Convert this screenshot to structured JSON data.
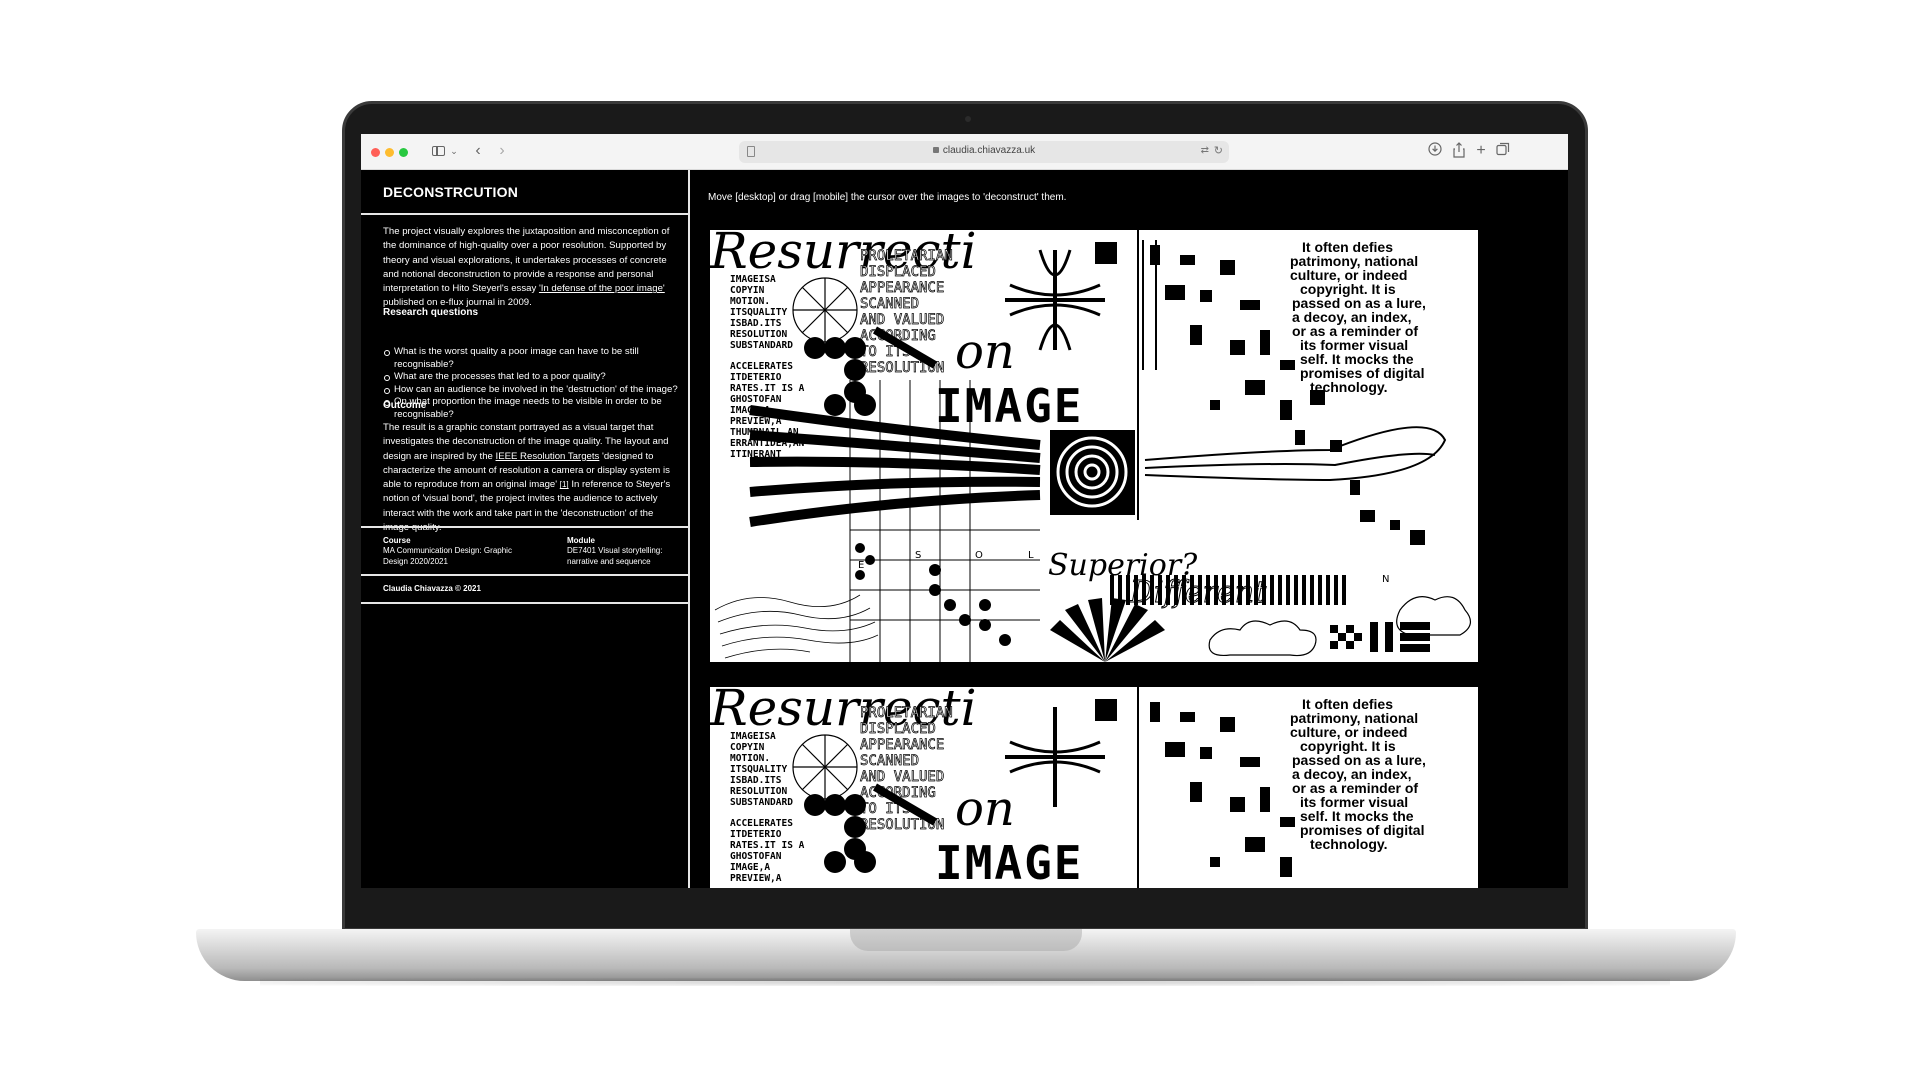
{
  "browser": {
    "url": "claudia.chiavazza.uk"
  },
  "sidebar": {
    "title": "DECONSTRCUTION",
    "intro_pre": "The project visually explores the juxtaposition and misconception of the dominance of high-quality over a poor resolution. Supported by theory and visual explorations, it undertakes processes of concrete and notional deconstruction to provide a response and personal interpretation to Hito Steyerl's essay ",
    "intro_link": "'In defense of the poor image'",
    "intro_post": " published on e-flux journal in 2009.",
    "research_heading": "Research questions",
    "research_questions": [
      "What is the worst quality a poor image can have to be still recognisable?",
      "What are the processes that led to a poor quality?",
      "How can an audience be involved in the 'destruction' of the image?",
      "On what proportion the image needs to be visible in order to be recognisable?"
    ],
    "outcome_heading": "Outcome",
    "outcome_pre": "The result is a graphic constant portrayed as a visual target that investigates the deconstruction of the image quality. The layout and design are inspired by the ",
    "outcome_link": "IEEE Resolution Targets",
    "outcome_mid": " 'designed to characterize the amount of resolution a camera or display system is able to reproduce from an original image' ",
    "outcome_ref": "[1]",
    "outcome_post": " In reference to Steyer's notion of 'visual bond', the project invites the audience to actively interact with the work and take part in the 'deconstruction' of the image quality.",
    "course_label": "Course",
    "course_value": "MA Communication Design: Graphic Design 2020/2021",
    "module_label": "Module",
    "module_value": "DE7401 Visual storytelling: narrative and sequence",
    "copyright": "Claudia Chiavazza © 2021"
  },
  "main": {
    "instruction": "Move [desktop] or drag [mobile] the cursor over the images to 'deconstruct' them.",
    "artwork": {
      "word_resurrection": "Resurrecti",
      "word_on": "on",
      "word_image": "IMAGE",
      "word_superior": "Superior?",
      "word_different": "Different",
      "column_text": [
        "IMAGEISA",
        "COPYIN",
        "MOTION.",
        "ITSQUALITY",
        "ISBAD.ITS",
        "RESOLUTION",
        "SUBSTANDARD",
        "ACCELERATES",
        "ITDETERIO",
        "RATES.IT IS A",
        "GHOSTOFAN",
        "IMAGE,A",
        "PREVIEW,A",
        "THUMBNAIL,AN",
        "ERRANTIDEA,AN",
        "ITINERANT"
      ],
      "mid_text": [
        "PROLETARIAN",
        "DISPLACED",
        "APPEARANCE",
        "SCANNED",
        "AND VALUED",
        "ACCORDING",
        "TO ITS",
        "RESOLUTION"
      ],
      "quote": [
        "It often defies",
        "patrimony, national",
        "culture, or indeed",
        "copyright. It is",
        "passed on as a lure,",
        "a decoy, an index,",
        "or as a reminder of",
        "its former visual",
        "self. It mocks the",
        "promises of digital",
        "technology."
      ],
      "scale_letters": [
        "E",
        "S",
        "O",
        "L",
        "N"
      ]
    },
    "colors": {
      "background": "#000000",
      "foreground": "#ffffff",
      "chrome": "#f4f4f4"
    }
  }
}
